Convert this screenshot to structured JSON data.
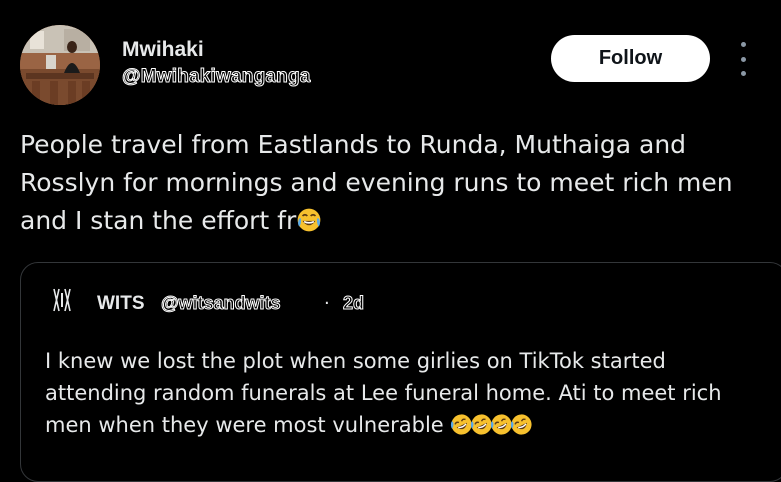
{
  "post": {
    "author_name": "Mwihaki",
    "author_handle": "@Mwihakiwanganga",
    "follow_label": "Follow",
    "text": "People travel from Eastlands to Runda, Muthaiga and Rosslyn for mornings and evening runs to meet rich men and I stan the effort fr",
    "text_emoji": "face-with-tears-of-joy-emoji"
  },
  "quote": {
    "author_name": "WITS",
    "author_handle": "@witsandwits",
    "separator": "·",
    "time": "2d",
    "text": "I knew we lost the plot when some girlies on TikTok  started attending random funerals at Lee funeral home. Ati to meet rich men when they were most vulnerable ",
    "text_emojis": [
      "rolling-on-floor-laughing-emoji",
      "rolling-on-floor-laughing-emoji",
      "rolling-on-floor-laughing-emoji",
      "rolling-on-floor-laughing-emoji"
    ]
  },
  "icons": {
    "more": "more-vertical-icon",
    "quote_logo": "wits-logo-icon"
  },
  "colors": {
    "background": "#000000",
    "text": "#e7e9ea",
    "muted": "#8b98a5",
    "border": "#333639",
    "follow_bg": "#ffffff",
    "follow_text": "#0f1419"
  }
}
